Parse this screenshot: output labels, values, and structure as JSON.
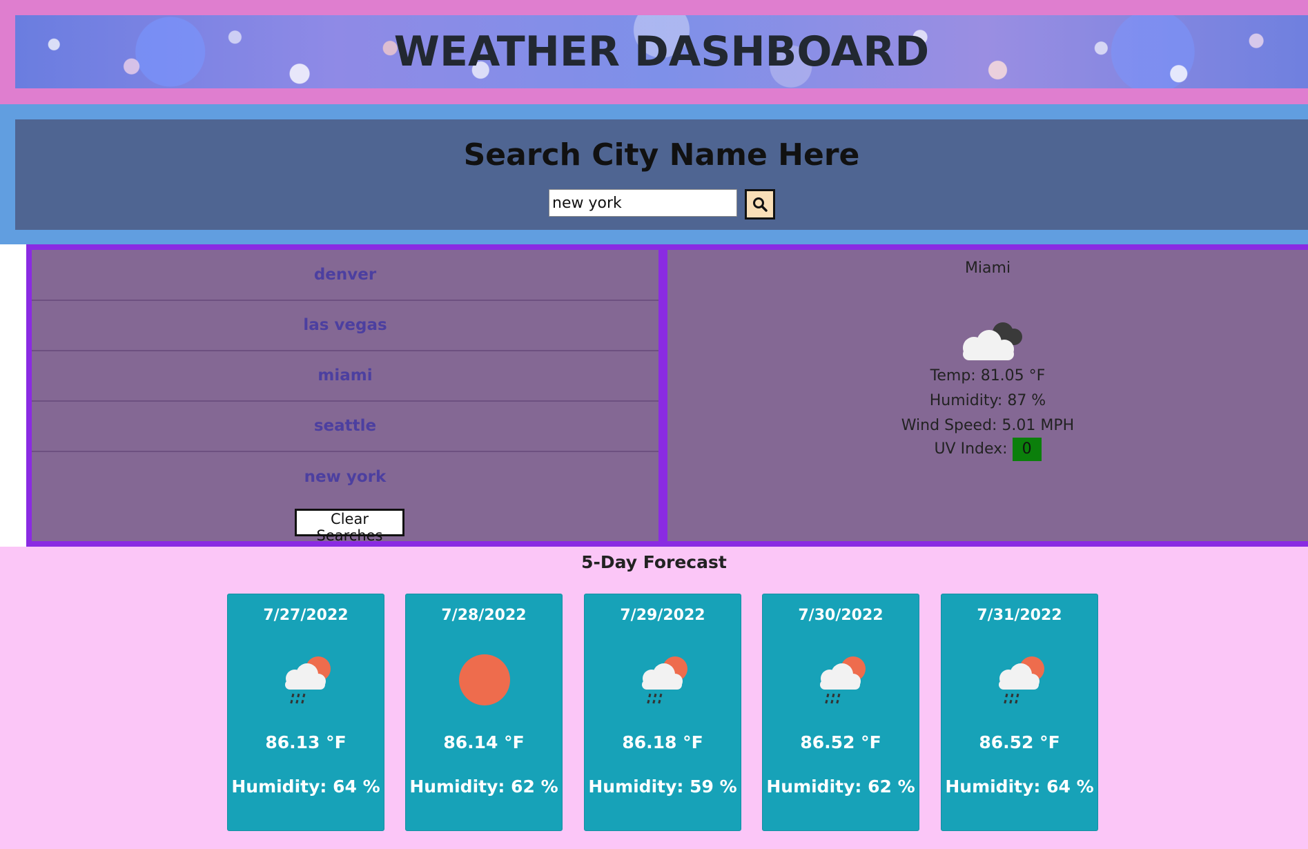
{
  "header": {
    "title": "WEATHER DASHBOARD"
  },
  "search": {
    "heading": "Search City Name Here",
    "input_value": "new york",
    "button_icon": "search-icon"
  },
  "history": {
    "items": [
      "denver",
      "las vegas",
      "miami",
      "seattle",
      "new york"
    ],
    "clear_label": "Clear Searches"
  },
  "current": {
    "city": "Miami",
    "icon": "cloudy-icon",
    "temp": "Temp: 81.05 °F",
    "humidity": "Humidity: 87 %",
    "wind": "Wind Speed: 5.01 MPH",
    "uv_label": "UV Index:",
    "uv_value": "0",
    "uv_color": "#0b7f0b"
  },
  "forecast": {
    "title": "5-Day Forecast",
    "days": [
      {
        "date": "7/27/2022",
        "icon": "rain-sun-icon",
        "temp": "86.13 °F",
        "humidity": "Humidity: 64 %"
      },
      {
        "date": "7/28/2022",
        "icon": "sun-icon",
        "temp": "86.14 °F",
        "humidity": "Humidity: 62 %"
      },
      {
        "date": "7/29/2022",
        "icon": "rain-sun-icon",
        "temp": "86.18 °F",
        "humidity": "Humidity: 59 %"
      },
      {
        "date": "7/30/2022",
        "icon": "rain-sun-icon",
        "temp": "86.52 °F",
        "humidity": "Humidity: 62 %"
      },
      {
        "date": "7/31/2022",
        "icon": "rain-sun-icon",
        "temp": "86.52 °F",
        "humidity": "Humidity: 64 %"
      }
    ]
  },
  "colors": {
    "header_band": "#df7ecf",
    "search_band": "#619ee0",
    "search_panel": "#4f6592",
    "middle_border": "#8a2be2",
    "panel": "#846894",
    "history_text": "#4c3fa0",
    "forecast_bg": "#fbc6f7",
    "card_bg": "#17a2b8"
  }
}
